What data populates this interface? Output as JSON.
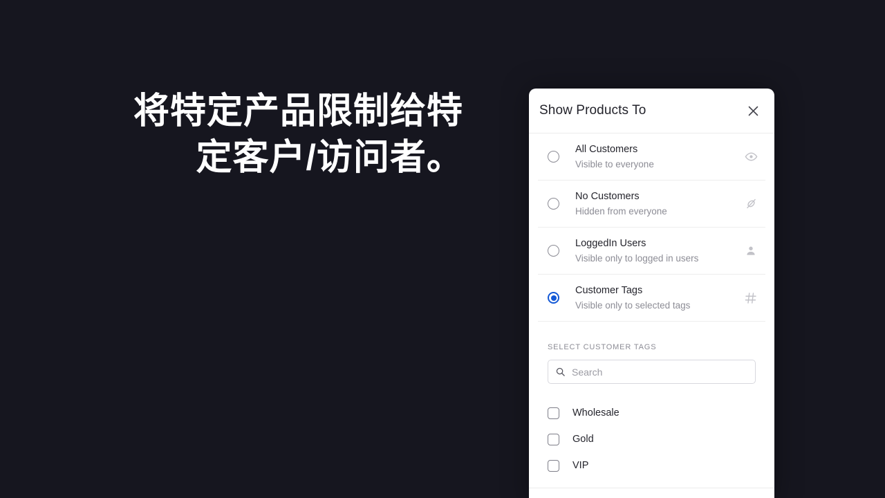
{
  "background": {
    "color": "#16161f"
  },
  "headline": {
    "text": "将特定产品限制给特定客户/访问者。",
    "color": "#ffffff"
  },
  "panel": {
    "accent_color": "#1459d6",
    "header": {
      "title": "Show Products To",
      "close_icon": "close-icon"
    },
    "options": [
      {
        "label": "All Customers",
        "description": "Visible to everyone",
        "icon": "eye-icon",
        "selected": false
      },
      {
        "label": "No Customers",
        "description": "Hidden from everyone",
        "icon": "eye-off-icon",
        "selected": false
      },
      {
        "label": "LoggedIn Users",
        "description": "Visible only to logged in users",
        "icon": "person-icon",
        "selected": false
      },
      {
        "label": "Customer Tags",
        "description": "Visible only to selected tags",
        "icon": "hash-icon",
        "selected": true
      }
    ],
    "tags_section": {
      "label": "SELECT CUSTOMER TAGS",
      "search": {
        "placeholder": "Search",
        "value": "",
        "icon": "search-icon"
      },
      "tags": [
        {
          "label": "Wholesale",
          "checked": false
        },
        {
          "label": "Gold",
          "checked": false
        },
        {
          "label": "VIP",
          "checked": false
        }
      ]
    }
  }
}
